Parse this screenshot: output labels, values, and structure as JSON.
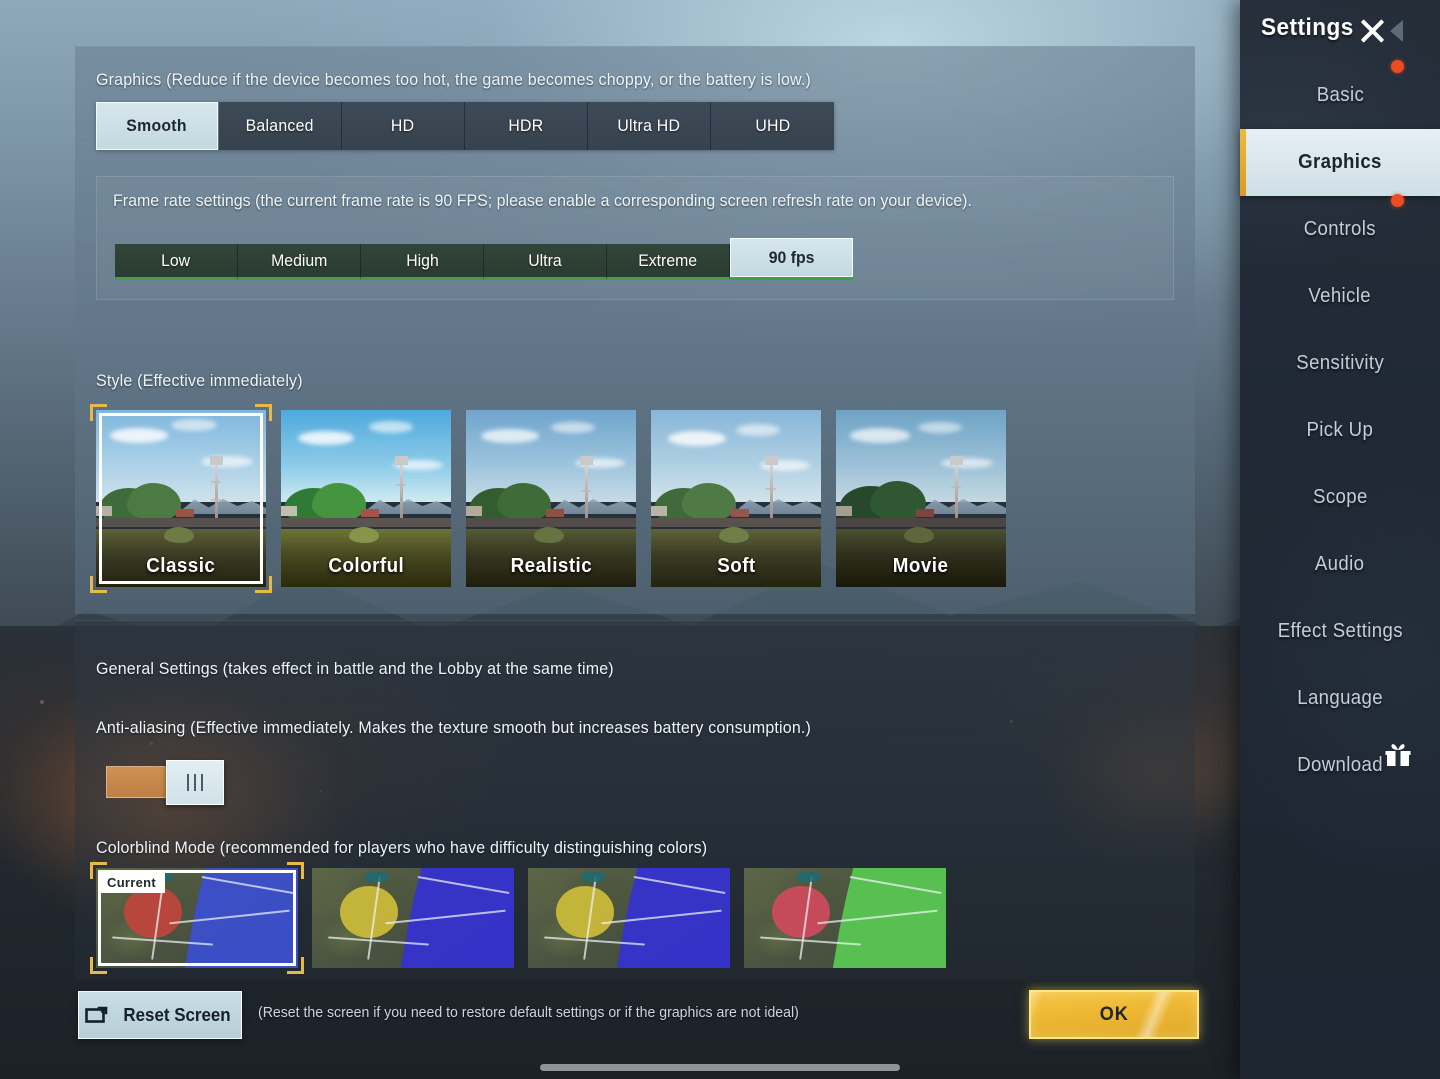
{
  "sidebar": {
    "title": "Settings",
    "close_icon": "close-x-icon",
    "collapse_icon": "triangle-left-icon",
    "items": [
      {
        "label": "Basic",
        "active": false,
        "badge": true,
        "gift": false
      },
      {
        "label": "Graphics",
        "active": true,
        "badge": false,
        "gift": false
      },
      {
        "label": "Controls",
        "active": false,
        "badge": true,
        "gift": false
      },
      {
        "label": "Vehicle",
        "active": false,
        "badge": false,
        "gift": false
      },
      {
        "label": "Sensitivity",
        "active": false,
        "badge": false,
        "gift": false
      },
      {
        "label": "Pick Up",
        "active": false,
        "badge": false,
        "gift": false
      },
      {
        "label": "Scope",
        "active": false,
        "badge": false,
        "gift": false
      },
      {
        "label": "Audio",
        "active": false,
        "badge": false,
        "gift": false
      },
      {
        "label": "Effect Settings",
        "active": false,
        "badge": false,
        "gift": false
      },
      {
        "label": "Language",
        "active": false,
        "badge": false,
        "gift": false
      },
      {
        "label": "Download",
        "active": false,
        "badge": false,
        "gift": true
      }
    ]
  },
  "graphics": {
    "heading": "Graphics (Reduce if the device becomes too hot, the game becomes choppy, or the battery is low.)",
    "quality_options": [
      {
        "label": "Smooth",
        "selected": true
      },
      {
        "label": "Balanced",
        "selected": false
      },
      {
        "label": "HD",
        "selected": false
      },
      {
        "label": "HDR",
        "selected": false
      },
      {
        "label": "Ultra HD",
        "selected": false
      },
      {
        "label": "UHD",
        "selected": false
      }
    ]
  },
  "frame_rate": {
    "heading": "Frame rate settings (the current frame rate is 90 FPS; please enable a corresponding screen refresh rate on your device).",
    "options": [
      {
        "label": "Low",
        "selected": false
      },
      {
        "label": "Medium",
        "selected": false
      },
      {
        "label": "High",
        "selected": false
      },
      {
        "label": "Ultra",
        "selected": false
      },
      {
        "label": "Extreme",
        "selected": false
      },
      {
        "label": "90 fps",
        "selected": true
      }
    ]
  },
  "style": {
    "heading": "Style (Effective immediately)",
    "options": [
      {
        "label": "Classic",
        "selected": true
      },
      {
        "label": "Colorful",
        "selected": false
      },
      {
        "label": "Realistic",
        "selected": false
      },
      {
        "label": "Soft",
        "selected": false
      },
      {
        "label": "Movie",
        "selected": false
      }
    ]
  },
  "general": {
    "heading": "General Settings (takes effect in battle and the Lobby at the same time)",
    "anti_aliasing": {
      "label": "Anti-aliasing (Effective immediately. Makes the texture smooth but increases battery consumption.)",
      "enabled": true
    }
  },
  "colorblind": {
    "heading": "Colorblind Mode (recommended for players who have difficulty distinguishing colors)",
    "current_badge": "Current",
    "options": [
      {
        "selected": true,
        "zone_color": "#c0443c",
        "area_color": "#3a4fd8"
      },
      {
        "selected": false,
        "zone_color": "#cdbc3a",
        "area_color": "#3430d6"
      },
      {
        "selected": false,
        "zone_color": "#cdbc3a",
        "area_color": "#3430d6"
      },
      {
        "selected": false,
        "zone_color": "#d04a5c",
        "area_color": "#59cc52"
      }
    ]
  },
  "footer": {
    "reset_label": "Reset Screen",
    "reset_icon": "reset-screen-icon",
    "reset_hint": "(Reset the screen if you need to restore default settings or if the graphics are not ideal)",
    "ok_label": "OK"
  },
  "colors": {
    "accent_gold": "#e9b84a",
    "selected_tab": "#d6e7ec",
    "fps_green": "#3fa23f",
    "toggle_on": "#c2854a",
    "badge_red": "#ef4a23",
    "ok_button": "#eeb834"
  }
}
